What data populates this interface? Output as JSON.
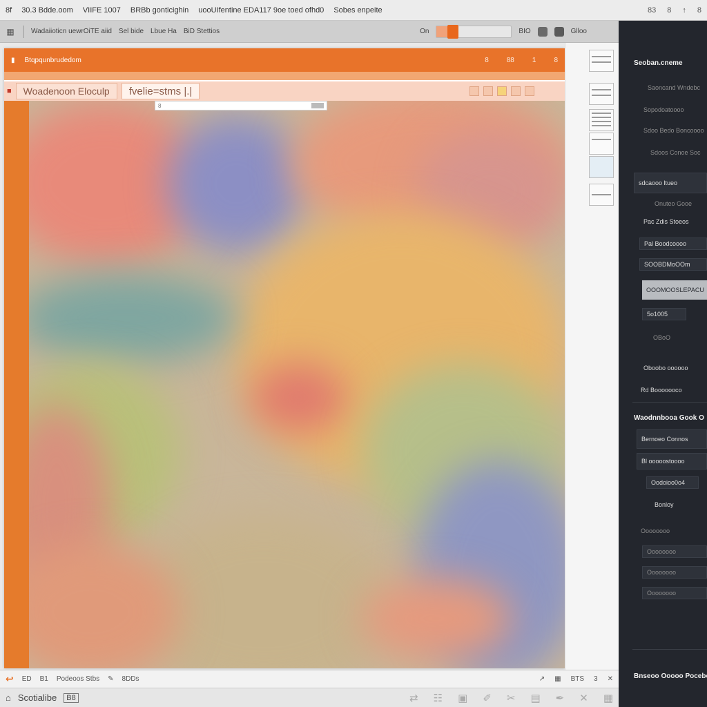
{
  "titlebar": {
    "items": [
      "8f",
      "30.3 Bdde.oom",
      "VIIFE 1007",
      "BRBb gonticighin",
      "uooUIfentine EDA117 9oe toed ofhd0",
      "Sobes enpeite"
    ],
    "controls": [
      "83",
      "8",
      "↑",
      "8"
    ]
  },
  "toolbar": {
    "labels": [
      "Wadaiioticn uewrOiTE aiid",
      "Sel bide",
      "Lbue Ha",
      "BiD Stettios"
    ],
    "zoom_label": "On",
    "zoom_value_label": "BIO",
    "zoom_level": 0.22,
    "menu_label": "Glloo"
  },
  "document": {
    "header_title": "Btqpqunbrudedom",
    "header_right": [
      "8",
      "88",
      "1",
      "8"
    ],
    "tabs": [
      "Woadenoon Eloculp",
      "fvelie=stms |.|"
    ],
    "search_placeholder": "",
    "search_value": "8"
  },
  "panel": {
    "heading_top": "Seoban.cneme",
    "items": [
      "Saoncand Wndebc",
      "Sopodoatoooo",
      "Sdoo Bedo Boncoooo",
      "Sdoos Conoe Soc",
      "sdcaooo ltueo",
      "Onuteo Gooe",
      "Pac Zdis Stoeos",
      "Pal Boodcoooo",
      "SOOBDMoOOm",
      "OOOMOOSLEPACU",
      "5o1005",
      "OBoO",
      "Oboobo oooooo",
      "Rd Booooooco"
    ],
    "heading_mid": "Waodnnbooa Gook O",
    "items2": [
      "Bernoeo Connos",
      "Bl ooooostoooo",
      "Oodoioo0o4",
      "Bonloy",
      "Oooooooo",
      "Oooooooo",
      "Oooooooo",
      "Oooooooo"
    ],
    "heading_bottom": "Bnseoo Ooooo Poceboss"
  },
  "statusbar": {
    "left": [
      "ED",
      "B1",
      "Podeoos Stbs"
    ],
    "mid": "8DDs",
    "right": [
      "BTS",
      "3"
    ]
  },
  "bottombar": {
    "label": "Scotialibe",
    "badge": "B8"
  },
  "colors": {
    "accent": "#e8732a",
    "panel_bg": "#23262d"
  }
}
